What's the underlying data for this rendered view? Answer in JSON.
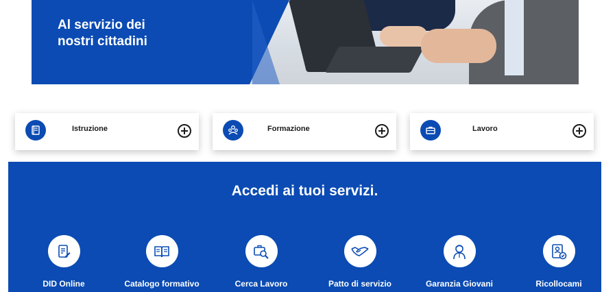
{
  "hero": {
    "title_line1": "Al servizio dei",
    "title_line2": "nostri cittadini"
  },
  "categories": [
    {
      "label": "Istruzione",
      "icon": "book-icon"
    },
    {
      "label": "Formazione",
      "icon": "group-icon"
    },
    {
      "label": "Lavoro",
      "icon": "briefcase-icon"
    }
  ],
  "services": {
    "title": "Accedi ai tuoi servizi.",
    "items": [
      {
        "label": "DID Online",
        "icon": "document-edit-icon"
      },
      {
        "label": "Catalogo formativo",
        "icon": "catalog-book-icon"
      },
      {
        "label": "Cerca Lavoro",
        "icon": "job-search-icon"
      },
      {
        "label": "Patto di servizio",
        "icon": "handshake-icon"
      },
      {
        "label": "Garanzia Giovani",
        "icon": "young-person-icon"
      },
      {
        "label": "Ricollocami",
        "icon": "id-badge-check-icon"
      }
    ]
  },
  "colors": {
    "brand_blue": "#0b4bb3",
    "white": "#ffffff",
    "text_dark": "#1b1b1b"
  }
}
